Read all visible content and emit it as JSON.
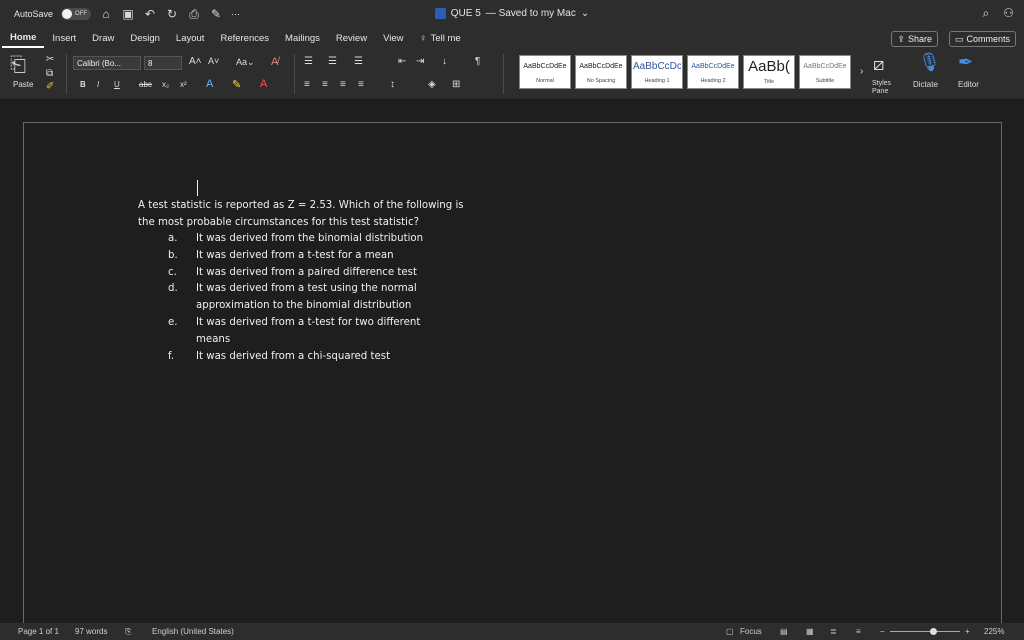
{
  "titlebar": {
    "autosave_label": "AutoSave",
    "autosave_state": "OFF",
    "doc_name": "QUE 5",
    "doc_status": "— Saved to my Mac",
    "more": "···"
  },
  "tabs": [
    "Home",
    "Insert",
    "Draw",
    "Design",
    "Layout",
    "References",
    "Mailings",
    "Review",
    "View"
  ],
  "tell_me": "Tell me",
  "share_label": "Share",
  "comments_label": "Comments",
  "ribbon": {
    "paste_label": "Paste",
    "font_name": "Calibri (Bo...",
    "font_size": "8",
    "styles": [
      {
        "sample": "AaBbCcDdEe",
        "name": "Normal"
      },
      {
        "sample": "AaBbCcDdEe",
        "name": "No Spacing"
      },
      {
        "sample": "AaBbCcDc",
        "name": "Heading 1"
      },
      {
        "sample": "AaBbCcDdEe",
        "name": "Heading 2"
      },
      {
        "sample": "AaBb(",
        "name": "Title"
      },
      {
        "sample": "AaBbCcDdEe",
        "name": "Subtitle"
      }
    ],
    "styles_pane_label": "Styles Pane",
    "dictate_label": "Dictate",
    "editor_label": "Editor"
  },
  "document": {
    "question": "A test statistic is reported as Z = 2.53. Which of the following is the most probable circumstances for this test statistic?",
    "options": [
      {
        "letter": "a.",
        "text": "It was derived from the binomial distribution"
      },
      {
        "letter": "b.",
        "text": "It was derived from a t-test for a mean"
      },
      {
        "letter": "c.",
        "text": "It was derived from a paired difference test"
      },
      {
        "letter": "d.",
        "text": "It was derived from a test using the normal approximation to the binomial distribution"
      },
      {
        "letter": "e.",
        "text": "It was derived from a t-test for two different means"
      },
      {
        "letter": "f.",
        "text": "It was derived from a chi-squared test"
      }
    ]
  },
  "statusbar": {
    "page": "Page 1 of 1",
    "words": "97 words",
    "language": "English (United States)",
    "focus": "Focus",
    "zoom": "225%"
  }
}
